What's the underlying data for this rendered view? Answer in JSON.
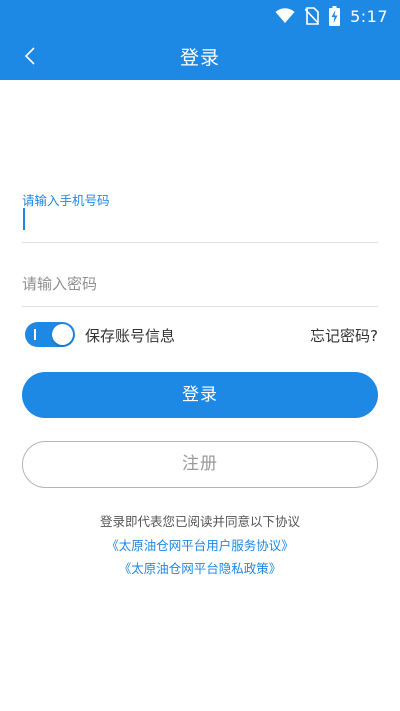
{
  "status_bar": {
    "time": "5:17",
    "icons": [
      "wifi-icon",
      "no-sim-icon",
      "battery-charging-icon"
    ]
  },
  "header": {
    "title": "登录",
    "back_icon": "chevron-left-icon"
  },
  "form": {
    "phone_label": "请输入手机号码",
    "phone_value": "",
    "password_placeholder": "请输入密码",
    "password_value": "",
    "remember_label": "保存账号信息",
    "remember_on": true,
    "forgot_label": "忘记密码?"
  },
  "buttons": {
    "login": "登录",
    "register": "注册"
  },
  "agreement": {
    "text": "登录即代表您已阅读并同意以下协议",
    "service_link": "《太原油仓网平台用户服务协议》",
    "privacy_link": "《太原油仓网平台隐私政策》"
  },
  "colors": {
    "accent": "#1e88e5",
    "divider": "#e2e2e2",
    "register_border": "#b5b5b5"
  }
}
